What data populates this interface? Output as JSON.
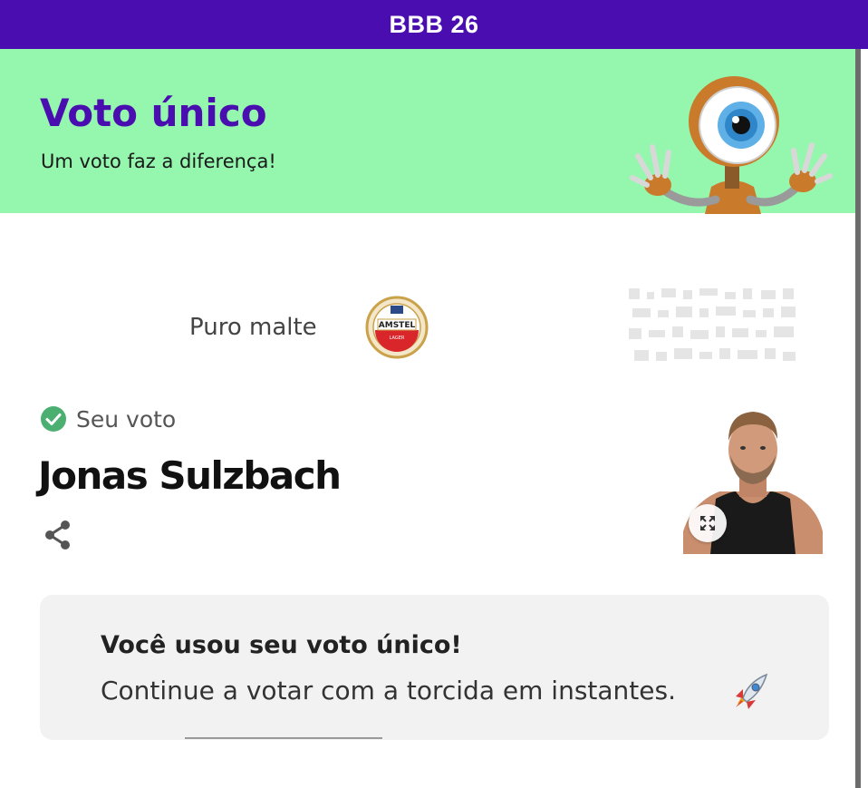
{
  "header": {
    "title": "BBB 26"
  },
  "banner": {
    "title": "Voto único",
    "subtitle": "Um voto faz a diferença!",
    "mascot_icon": "big-brother-eye-mascot"
  },
  "sponsor": {
    "label": "Puro malte",
    "logo_icon": "amstel-lager-logo",
    "logo_text": "AMSTEL",
    "logo_subtext": "LAGER"
  },
  "vote": {
    "status_label": "Seu voto",
    "candidate_name": "Jonas Sulzbach",
    "share_icon": "share-icon",
    "expand_icon": "expand-icon"
  },
  "info": {
    "title": "Você usou seu voto único!",
    "text": "Continue a votar com a torcida em instantes.",
    "emoji_icon": "rocket-icon"
  },
  "colors": {
    "brand_purple": "#4a0eb0",
    "banner_green": "#95f6ae",
    "check_green": "#4caf72",
    "card_gray": "#f2f2f2"
  }
}
